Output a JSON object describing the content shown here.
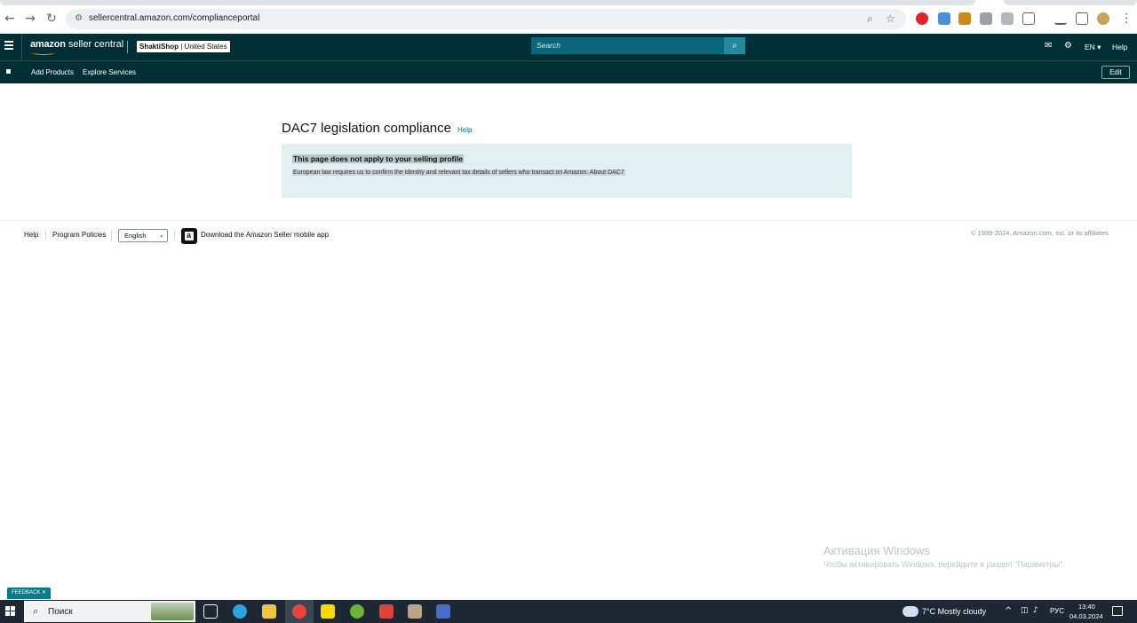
{
  "browser": {
    "url": "sellercentral.amazon.com/complianceportal",
    "icons": [
      "back-icon",
      "forward-icon",
      "reload-icon",
      "site-info-icon",
      "zoom-icon",
      "bookmark-star-icon"
    ]
  },
  "header": {
    "logo_brand": "amazon",
    "logo_product": "seller central",
    "store_name": "ShaktiShop",
    "store_region": "United States",
    "search_placeholder": "Search",
    "language": "EN",
    "help_label": "Help",
    "accent_color": "#002f36"
  },
  "subnav": {
    "links": [
      "Add Products",
      "Explore Services"
    ],
    "edit_label": "Edit"
  },
  "main": {
    "title": "DAC7 legislation compliance",
    "title_help": "Help",
    "notice_heading": "This page does not apply to your selling profile",
    "notice_text": "European law requires us to confirm the identity and relevant tax details of sellers who transact on Amazon. About DAC7"
  },
  "footer": {
    "help": "Help",
    "program_policies": "Program Policies",
    "language_selected": "English",
    "app_download": "Download the Amazon Seller mobile app",
    "copyright": "© 1999-2024, Amazon.com, Inc. or its affiliates"
  },
  "watermark": {
    "title": "Активация Windows",
    "text": "Чтобы активировать Windows, перейдите в раздел \"Параметры\"."
  },
  "feedback_label": "FEEDBACK ✕",
  "taskbar": {
    "search_label": "Поиск",
    "weather": "7°C  Mostly cloudy",
    "language": "РУС",
    "time": "13:40",
    "date": "04.03.2024"
  }
}
